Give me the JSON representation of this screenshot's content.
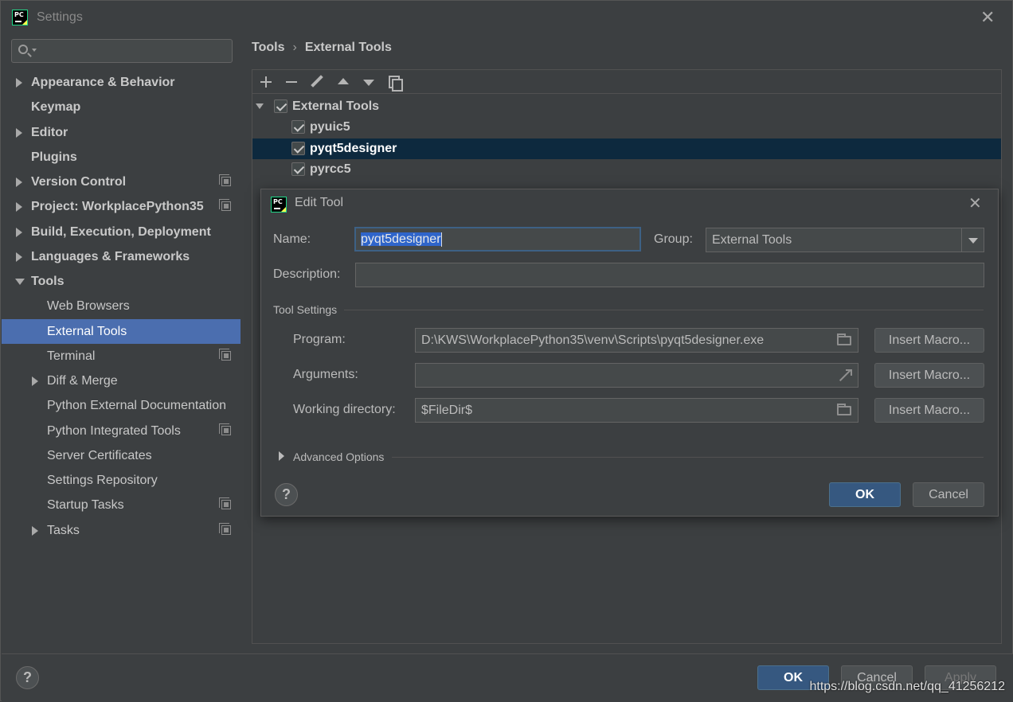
{
  "window": {
    "title": "Settings",
    "close": "✕"
  },
  "search": {
    "placeholder": ""
  },
  "sidebar": {
    "items": [
      {
        "label": "Appearance & Behavior"
      },
      {
        "label": "Keymap"
      },
      {
        "label": "Editor"
      },
      {
        "label": "Plugins"
      },
      {
        "label": "Version Control"
      },
      {
        "label": "Project: WorkplacePython35"
      },
      {
        "label": "Build, Execution, Deployment"
      },
      {
        "label": "Languages & Frameworks"
      },
      {
        "label": "Tools"
      },
      {
        "label": "Web Browsers"
      },
      {
        "label": "External Tools"
      },
      {
        "label": "Terminal"
      },
      {
        "label": "Diff & Merge"
      },
      {
        "label": "Python External Documentation"
      },
      {
        "label": "Python Integrated Tools"
      },
      {
        "label": "Server Certificates"
      },
      {
        "label": "Settings Repository"
      },
      {
        "label": "Startup Tasks"
      },
      {
        "label": "Tasks"
      }
    ]
  },
  "breadcrumb": {
    "parent": "Tools",
    "separator": "›",
    "current": "External Tools"
  },
  "tools_tree": {
    "group": "External Tools",
    "items": [
      "pyuic5",
      "pyqt5designer",
      "pyrcc5"
    ]
  },
  "edit_tool": {
    "title": "Edit Tool",
    "close": "✕",
    "name_label": "Name:",
    "name_value": "pyqt5designer",
    "group_label": "Group:",
    "group_value": "External Tools",
    "description_label": "Description:",
    "description_value": "",
    "tool_settings_label": "Tool Settings",
    "program_label": "Program:",
    "program_value": "D:\\KWS\\WorkplacePython35\\venv\\Scripts\\pyqt5designer.exe",
    "arguments_label": "Arguments:",
    "arguments_value": "",
    "workdir_label": "Working directory:",
    "workdir_value": "$FileDir$",
    "insert_macro": "Insert Macro...",
    "advanced_options": "Advanced Options",
    "help": "?",
    "ok": "OK",
    "cancel": "Cancel"
  },
  "footer": {
    "help": "?",
    "ok": "OK",
    "cancel": "Cancel",
    "apply": "Apply"
  },
  "watermark": "https://blog.csdn.net/qq_41256212",
  "colors": {
    "background": "#3c3f41",
    "selection": "#4b6eaf",
    "tree_selection": "#0d293e",
    "primary_button": "#365880"
  }
}
